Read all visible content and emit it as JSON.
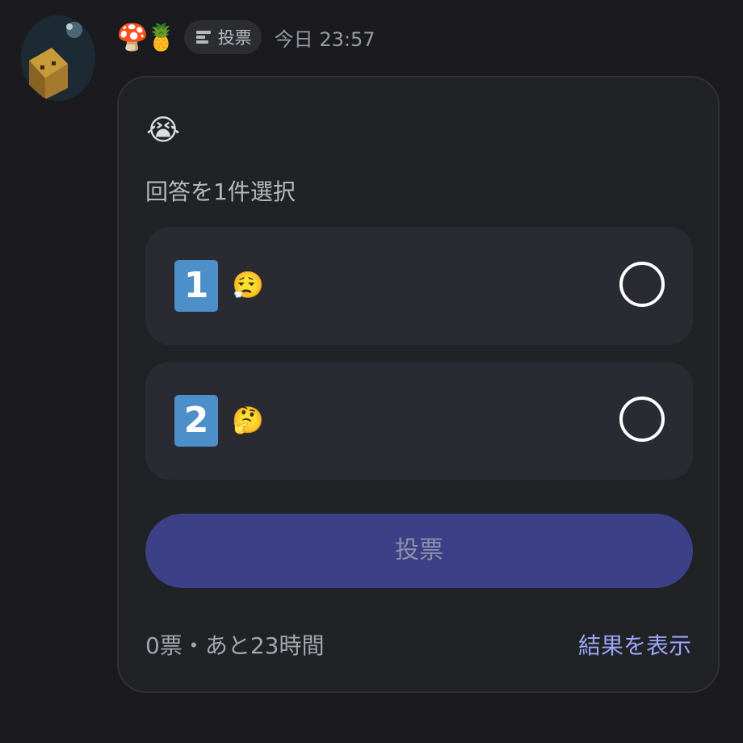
{
  "message": {
    "username": "🍄🍍",
    "tag_label": "投票",
    "timestamp": "今日 23:57"
  },
  "poll": {
    "question": "😭",
    "instruction": "回答を1件選択",
    "options": [
      {
        "key": "1",
        "emoji": "😮‍💨"
      },
      {
        "key": "2",
        "emoji": "🤔"
      }
    ],
    "vote_button_label": "投票",
    "status": "0票・あと23時間",
    "results_link_label": "結果を表示"
  },
  "colors": {
    "background": "#1b1b1f",
    "card": "#202226",
    "option_bg": "#2a2b32",
    "vote_button": "#3c4187",
    "link": "#9aa6f7",
    "keycap": "#4d8fc9"
  }
}
